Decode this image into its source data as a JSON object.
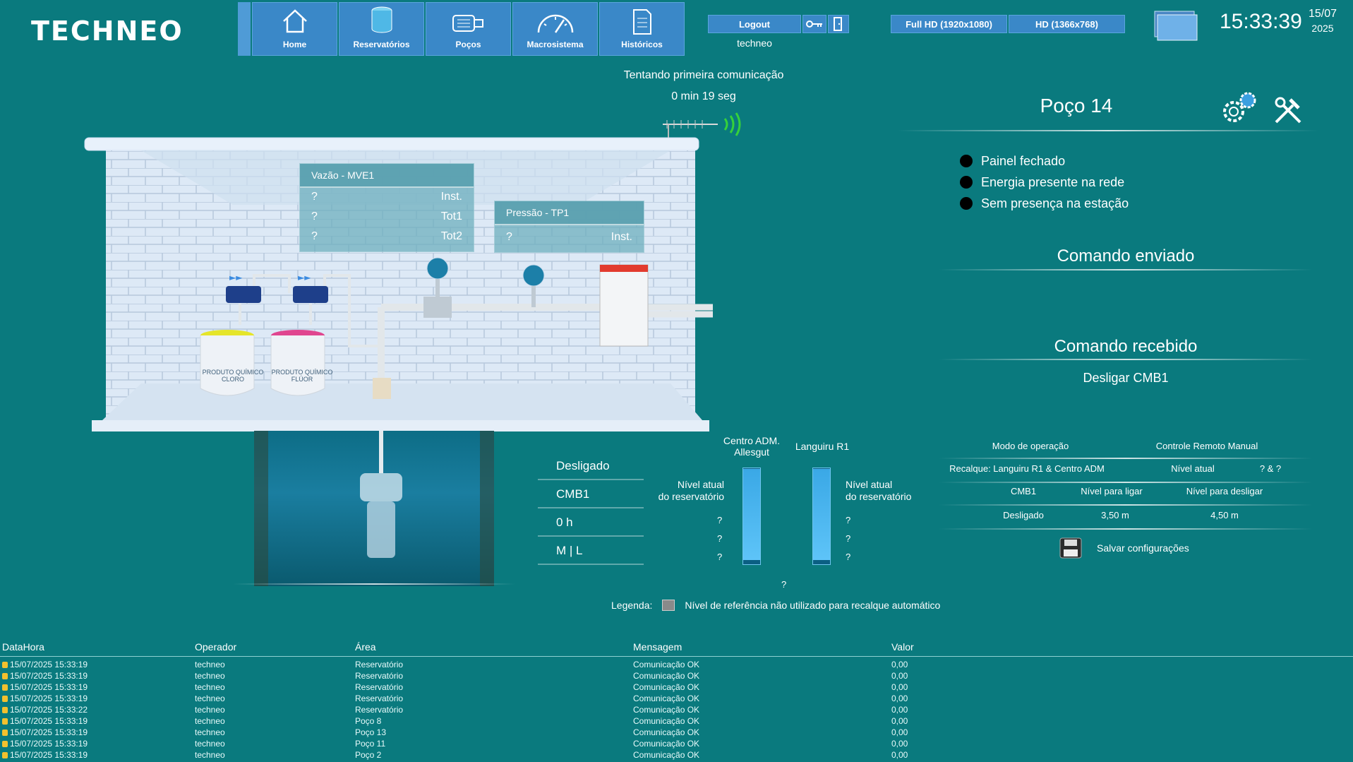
{
  "app": {
    "logo": "TECHNEO"
  },
  "nav": [
    {
      "label": "Home",
      "icon": "home-icon"
    },
    {
      "label": "Reservatórios",
      "icon": "reservoir-icon"
    },
    {
      "label": "Poços",
      "icon": "pump-icon"
    },
    {
      "label": "Macrosistema",
      "icon": "gauge-icon"
    },
    {
      "label": "Históricos",
      "icon": "document-icon"
    }
  ],
  "session": {
    "logout_label": "Logout",
    "user": "techneo"
  },
  "resolution": {
    "full_hd": "Full HD (1920x1080)",
    "hd": "HD (1366x768)"
  },
  "clock": {
    "time": "15:33:39",
    "day_month": "15/07",
    "year": "2025"
  },
  "comm": {
    "status": "Tentando primeira comunicação",
    "elapsed": "0 min 19 seg"
  },
  "flow": {
    "title": "Vazão - MVE1",
    "rows": [
      {
        "value": "?",
        "label": "Inst."
      },
      {
        "value": "?",
        "label": "Tot1"
      },
      {
        "value": "?",
        "label": "Tot2"
      }
    ]
  },
  "pressure": {
    "title": "Pressão - TP1",
    "value": "?",
    "label": "Inst."
  },
  "barrels": [
    {
      "label": "PRODUTO QUÍMICO CLORO"
    },
    {
      "label": "PRODUTO QUÍMICO FLÚOR"
    }
  ],
  "pump_info": {
    "state": "Desligado",
    "pump": "CMB1",
    "hours": "0 h",
    "mode": "M | L"
  },
  "reservoirs": {
    "left": {
      "name_line1": "Centro ADM.",
      "name_line2": "Allesgut",
      "level_label_1": "Nível atual",
      "level_label_2": "do reservatório",
      "values": [
        "?",
        "?",
        "?"
      ],
      "level_pct": 95
    },
    "right": {
      "name": "Languiru R1",
      "level_label_1": "Nível atual",
      "level_label_2": "do reservatório",
      "values": [
        "?",
        "?",
        "?"
      ],
      "level_pct": 95
    },
    "center_value": "?"
  },
  "legend": {
    "label": "Legenda:",
    "text": "Nível de referência não utilizado para recalque automático"
  },
  "well": {
    "title": "Poço 14",
    "alarms": [
      "Painel fechado",
      "Energia presente na rede",
      "Sem presença na estação"
    ],
    "cmd_sent_title": "Comando enviado",
    "cmd_sent_value": "",
    "cmd_recv_title": "Comando recebido",
    "cmd_recv_value": "Desligar CMB1"
  },
  "config": {
    "mode_label": "Modo de operação",
    "mode_value": "Controle Remoto Manual",
    "recalque_label": "Recalque: Languiru R1 & Centro ADM",
    "current_level_label": "Nível atual",
    "current_level_value": "? & ?",
    "pump_label": "CMB1",
    "on_level_label": "Nível para ligar",
    "off_level_label": "Nível para desligar",
    "pump_state": "Desligado",
    "on_level": "3,50 m",
    "off_level": "4,50 m",
    "save_label": "Salvar configurações"
  },
  "events": {
    "columns": [
      "DataHora",
      "Operador",
      "Área",
      "Mensagem",
      "Valor"
    ],
    "rows": [
      [
        "15/07/2025 15:33:19",
        "techneo",
        "Reservatório",
        "Comunicação OK",
        "0,00"
      ],
      [
        "15/07/2025 15:33:19",
        "techneo",
        "Reservatório",
        "Comunicação OK",
        "0,00"
      ],
      [
        "15/07/2025 15:33:19",
        "techneo",
        "Reservatório",
        "Comunicação OK",
        "0,00"
      ],
      [
        "15/07/2025 15:33:19",
        "techneo",
        "Reservatório",
        "Comunicação OK",
        "0,00"
      ],
      [
        "15/07/2025 15:33:22",
        "techneo",
        "Reservatório",
        "Comunicação OK",
        "0,00"
      ],
      [
        "15/07/2025 15:33:19",
        "techneo",
        "Poço 8",
        "Comunicação OK",
        "0,00"
      ],
      [
        "15/07/2025 15:33:19",
        "techneo",
        "Poço 13",
        "Comunicação OK",
        "0,00"
      ],
      [
        "15/07/2025 15:33:19",
        "techneo",
        "Poço 11",
        "Comunicação OK",
        "0,00"
      ],
      [
        "15/07/2025 15:33:19",
        "techneo",
        "Poço 2",
        "Comunicação OK",
        "0,00"
      ]
    ]
  }
}
